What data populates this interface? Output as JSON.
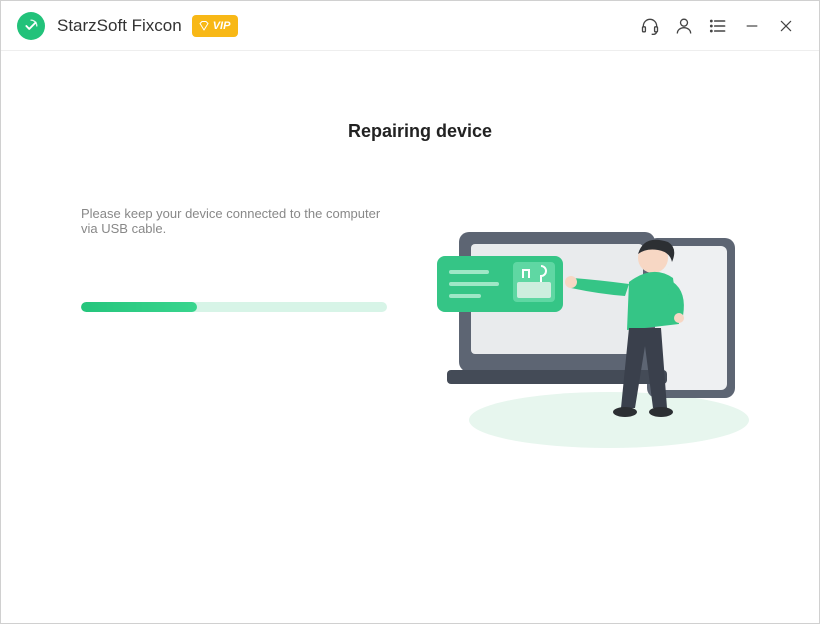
{
  "header": {
    "app_title": "StarzSoft Fixcon",
    "vip_label": "VIP"
  },
  "main": {
    "heading": "Repairing device",
    "instruction": "Please keep your device connected to the computer via USB cable.",
    "progress_percent": 38
  },
  "colors": {
    "accent": "#22c27a",
    "vip": "#f8b816"
  }
}
